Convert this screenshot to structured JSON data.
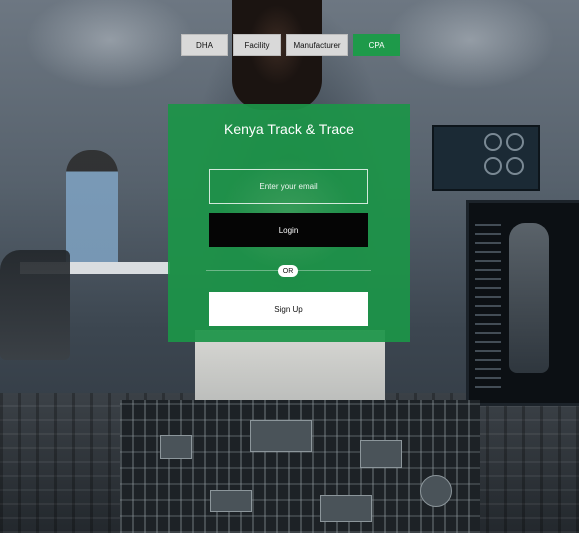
{
  "app": {
    "title": "Kenya Track & Trace"
  },
  "roles": {
    "tabs": [
      {
        "label": "DHA",
        "selected": false
      },
      {
        "label": "Facility",
        "selected": false
      },
      {
        "label": "Manufacturer",
        "selected": false
      },
      {
        "label": "CPA",
        "selected": true
      }
    ]
  },
  "login_form": {
    "email_placeholder": "Enter your email",
    "email_value": "",
    "login_label": "Login",
    "divider_label": "OR",
    "signup_label": "Sign Up"
  },
  "colors": {
    "brand_green": "#1c9448",
    "selected_tab": "#1e9a4a",
    "tab_default": "#d9d9d9",
    "login_button": "#050505",
    "signup_button": "#ffffff"
  },
  "background": {
    "description_icon": "laboratory-background-image"
  }
}
